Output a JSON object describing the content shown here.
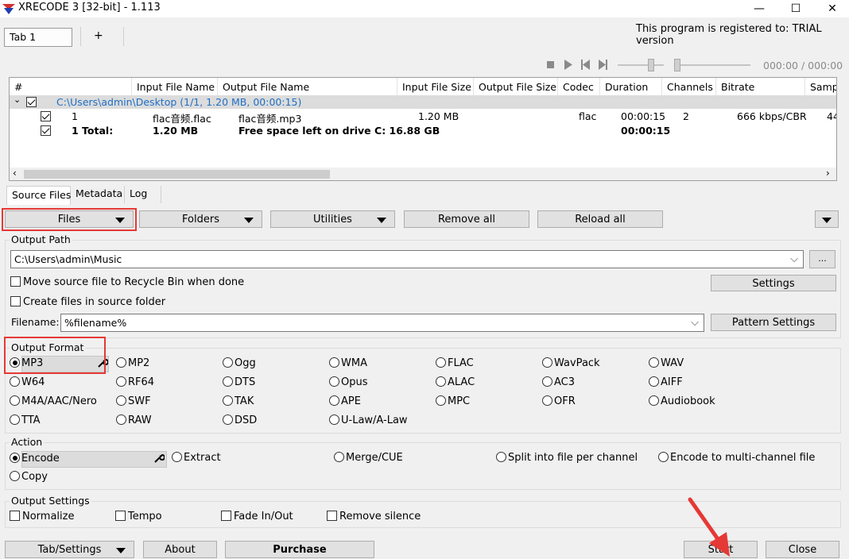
{
  "window": {
    "title": "XRECODE 3 [32-bit] - 1.113",
    "minimize": "—",
    "maximize": "☐",
    "close": "✕"
  },
  "tabs": {
    "items": [
      "Tab 1"
    ],
    "add": "+"
  },
  "registration": "This program is registered to: TRIAL version",
  "player": {
    "time": "000:00 / 000:00"
  },
  "table": {
    "columns": [
      "#",
      "Input File Name",
      "Output File Name",
      "Input File Size",
      "Output File Size",
      "Codec",
      "Duration",
      "Channels",
      "Bitrate",
      "Samp"
    ],
    "group": "C:\\Users\\admin\\Desktop (1/1, 1.20 MB, 00:00:15)",
    "rows": [
      {
        "num": "1",
        "input": "flac音频.flac",
        "output": "flac音频.mp3",
        "in_size": "1.20 MB",
        "codec": "flac",
        "duration": "00:00:15",
        "channels": "2",
        "bitrate": "666 kbps/CBR",
        "samp": "44"
      }
    ],
    "total": {
      "label": "1 Total:",
      "size": "1.20 MB",
      "free": "Free space left on drive C: 16.88 GB",
      "duration": "00:00:15"
    }
  },
  "subtabs": [
    "Source Files",
    "Metadata",
    "Log"
  ],
  "toolbar": {
    "files": "Files",
    "folders": "Folders",
    "utilities": "Utilities",
    "remove_all": "Remove all",
    "reload_all": "Reload all"
  },
  "output_path": {
    "label": "Output Path",
    "value": "C:\\Users\\admin\\Music",
    "browse": "...",
    "move_recycle": "Move source file to Recycle Bin when done",
    "create_in_source": "Create files in source folder",
    "settings": "Settings",
    "filename_label": "Filename:",
    "filename_value": "%filename%",
    "pattern_settings": "Pattern Settings"
  },
  "output_format": {
    "label": "Output Format",
    "selected": "MP3",
    "formats": [
      "MP3",
      "MP2",
      "Ogg",
      "WMA",
      "FLAC",
      "WavPack",
      "WAV",
      "W64",
      "RF64",
      "DTS",
      "Opus",
      "ALAC",
      "AC3",
      "AIFF",
      "M4A/AAC/Nero",
      "SWF",
      "TAK",
      "APE",
      "MPC",
      "OFR",
      "Audiobook",
      "TTA",
      "RAW",
      "DSD",
      "U-Law/A-Law"
    ]
  },
  "action": {
    "label": "Action",
    "encode": "Encode",
    "extract": "Extract",
    "merge": "Merge/CUE",
    "split": "Split into file per channel",
    "multichannel": "Encode to multi-channel file",
    "copy": "Copy"
  },
  "output_settings": {
    "label": "Output Settings",
    "normalize": "Normalize",
    "tempo": "Tempo",
    "fade": "Fade In/Out",
    "remove_silence": "Remove silence"
  },
  "bottom": {
    "tab_settings": "Tab/Settings",
    "about": "About",
    "purchase": "Purchase",
    "start": "Start",
    "close": "Close"
  },
  "colors": {
    "group_row": "#dcdcdc",
    "group_text": "#1f6fc5",
    "highlight": "#e53935"
  }
}
